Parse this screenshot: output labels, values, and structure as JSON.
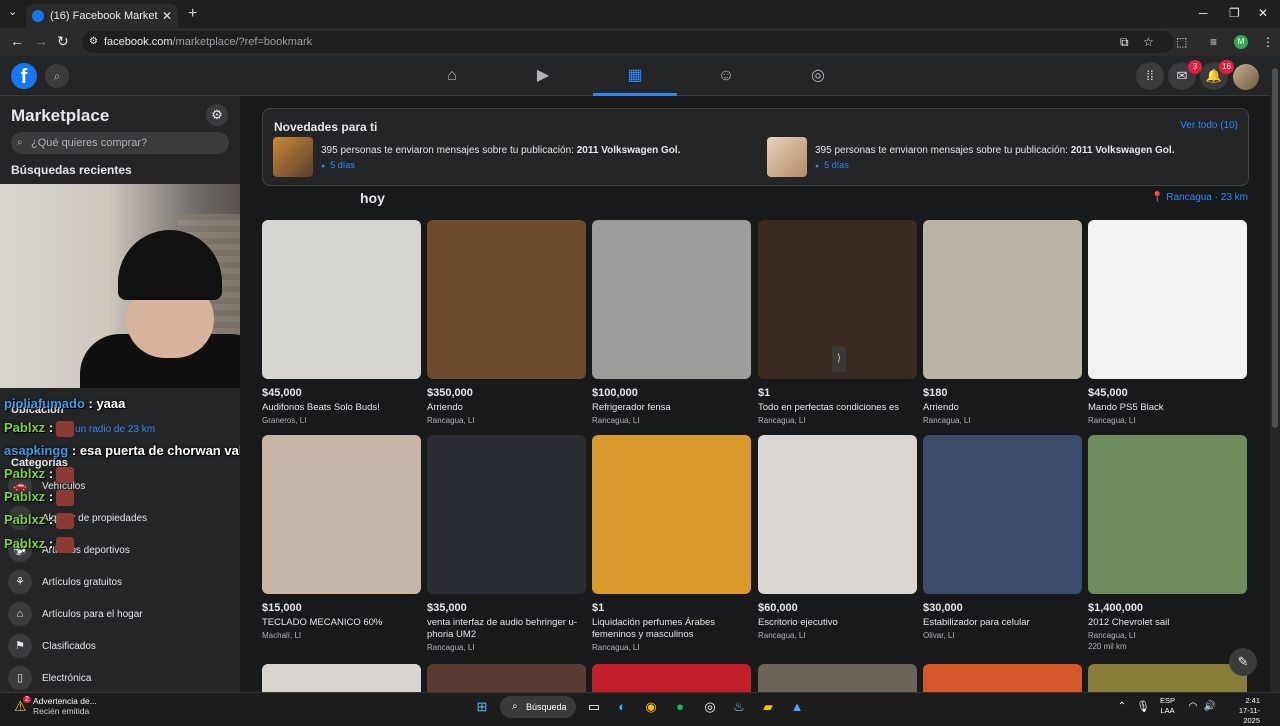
{
  "browser": {
    "tab_title": "(16) Facebook Marketplace | Fa",
    "tab_close": "✕",
    "new_tab": "+",
    "url_host": "facebook.com",
    "url_path": "/marketplace/?ref=bookmark"
  },
  "fb_header": {
    "logo": "f",
    "messenger_badge": "3",
    "notifications_badge": "16"
  },
  "sidebar": {
    "title": "Marketplace",
    "search_placeholder": "¿Qué quieres comprar?",
    "recent_searches": "Búsquedas recientes",
    "location_label": "Ubicación",
    "radius": "En un radio de 23 km",
    "categories_label": "Categorías",
    "items": [
      {
        "label": "Vehículos",
        "icon": "car-icon"
      },
      {
        "label": "Alquiler de propiedades",
        "icon": "house-icon"
      },
      {
        "label": "Artículos deportivos",
        "icon": "sport-icon"
      },
      {
        "label": "Artículos gratuitos",
        "icon": "gift-icon"
      },
      {
        "label": "Artículos para el hogar",
        "icon": "home-icon"
      },
      {
        "label": "Clasificados",
        "icon": "tag-icon"
      },
      {
        "label": "Electrónica",
        "icon": "phone-icon"
      }
    ]
  },
  "stream_chat": [
    {
      "user": "pioliafumado",
      "msg": ": yaaa"
    },
    {
      "user": "Pablxz",
      "msg": ":"
    },
    {
      "user": "asapkingg",
      "msg": ": esa puerta de chorwan vale 5 lucas"
    },
    {
      "user": "Pablxz",
      "msg": ":"
    },
    {
      "user": "Pablxz",
      "msg": ":"
    },
    {
      "user": "Pablxz",
      "msg": ":"
    },
    {
      "user": "Pablxz",
      "msg": ":"
    }
  ],
  "news": {
    "title": "Novedades para ti",
    "see_all": "Ver todo (10)",
    "items": [
      {
        "text": "395 personas te enviaron mensajes sobre tu publicación:",
        "bold": "2011 Volkswagen Gol.",
        "time": "5 días"
      },
      {
        "text": "395 personas te enviaron mensajes sobre tu publicación:",
        "bold": "2011 Volkswagen Gol.",
        "time": "5 días"
      }
    ]
  },
  "feed": {
    "section_title_suffix": "hoy",
    "location": "Rancagua · 23 km",
    "listings": [
      {
        "price": "$45,000",
        "title": "Audifonos Beats Solo Buds!",
        "location": "Graneros, LI",
        "color": "#d7d5d2"
      },
      {
        "price": "$350,000",
        "title": "Arriendo",
        "location": "Rancagua, LI",
        "color": "#6b4a2e"
      },
      {
        "price": "$100,000",
        "title": "Refrigerador fensa",
        "location": "Rancagua, LI",
        "color": "#9c9c9a"
      },
      {
        "price": "$1",
        "title": "Todo en perfectas condiciones es",
        "location": "Rancagua, LI",
        "color": "#3a2a22"
      },
      {
        "price": "$180",
        "title": "Arriendo",
        "location": "Rancagua, LI",
        "color": "#b9b3a8"
      },
      {
        "price": "$45,000",
        "title": "Mando PS5 Black",
        "location": "Rancagua, LI",
        "color": "#f2f2f2"
      },
      {
        "price": "$15,000",
        "title": "TECLADO MECANICO 60%",
        "location": "Machalí, LI",
        "color": "#c7b5a8"
      },
      {
        "price": "$35,000",
        "title": "venta interfaz de audio behringer u-phoria UM2",
        "location": "Rancagua, LI",
        "color": "#2a2c33"
      },
      {
        "price": "$1",
        "title": "Liquidación perfumes Árabes femeninos y masculinos",
        "location": "Rancagua, LI",
        "color": "#d89a2a"
      },
      {
        "price": "$60,000",
        "title": "Escritorio ejecutivo",
        "location": "Rancagua, LI",
        "color": "#d9d6d3"
      },
      {
        "price": "$30,000",
        "title": "Estabilizador para celular",
        "location": "Olivar, LI",
        "color": "#3b4b6a"
      },
      {
        "price": "$1,400,000",
        "title": "2012 Chevrolet sail",
        "location": "Rancagua, LI",
        "mileage": "220 mil km",
        "color": "#6f8c5c"
      }
    ]
  },
  "taskbar": {
    "notif_title": "Advertencia de...",
    "notif_sub": "Recién emitida",
    "notif_count": "2",
    "search": "Búsqueda",
    "lang1": "ESP",
    "lang2": "LAA",
    "time": "2:41",
    "date": "17-11-2025"
  }
}
